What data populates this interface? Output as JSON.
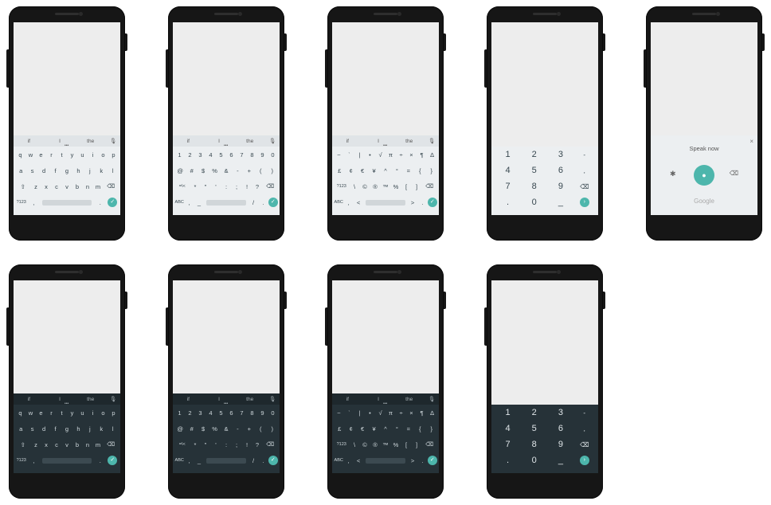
{
  "suggestions": [
    "if",
    "I",
    "the"
  ],
  "icons": {
    "mic": "mic-icon",
    "shift": "shift-icon",
    "backspace": "backspace-icon",
    "enter": "check-icon",
    "settings": "gear-icon",
    "close": "close-icon"
  },
  "accent_color": "#4db6ac",
  "qwerty": {
    "row1": [
      "q",
      "w",
      "e",
      "r",
      "t",
      "y",
      "u",
      "i",
      "o",
      "p"
    ],
    "row2": [
      "a",
      "s",
      "d",
      "f",
      "g",
      "h",
      "j",
      "k",
      "l"
    ],
    "row3": [
      "z",
      "x",
      "c",
      "v",
      "b",
      "n",
      "m"
    ],
    "mode_key": "?123",
    "comma": ",",
    "period": "."
  },
  "symbols1": {
    "row1": [
      "1",
      "2",
      "3",
      "4",
      "5",
      "6",
      "7",
      "8",
      "9",
      "0"
    ],
    "row2": [
      "@",
      "#",
      "$",
      "%",
      "&",
      "-",
      "+",
      "(",
      ")"
    ],
    "row3_mode": "=\\<",
    "row3": [
      "*",
      "\"",
      "'",
      ":",
      ";",
      "!",
      "?"
    ],
    "mode_key": "ABC",
    "left": [
      ",",
      "_"
    ],
    "right": [
      "/",
      "."
    ]
  },
  "symbols2": {
    "row1": [
      "~",
      "`",
      "|",
      "•",
      "√",
      "π",
      "÷",
      "×",
      "¶",
      "∆"
    ],
    "row2": [
      "£",
      "¢",
      "€",
      "¥",
      "^",
      "°",
      "=",
      "{",
      "}"
    ],
    "row3_mode": "?123",
    "row3": [
      "\\",
      "©",
      "®",
      "™",
      "%",
      "[",
      "]"
    ],
    "mode_key": "ABC",
    "left": [
      ",",
      "<"
    ],
    "right": [
      ">",
      "."
    ]
  },
  "numpad": {
    "rows": [
      [
        "1",
        "2",
        "3",
        "-"
      ],
      [
        "4",
        "5",
        "6",
        ","
      ],
      [
        "7",
        "8",
        "9",
        "⌫"
      ],
      [
        ".",
        "0",
        "_",
        "›"
      ]
    ]
  },
  "voice": {
    "title": "Speak now",
    "brand": "Google",
    "close": "×",
    "settings": "✱",
    "mic": "●",
    "delete": "⌫"
  },
  "glyphs": {
    "mic": "🎙",
    "shift": "⇧",
    "backspace": "⌫",
    "enter": "✓"
  }
}
